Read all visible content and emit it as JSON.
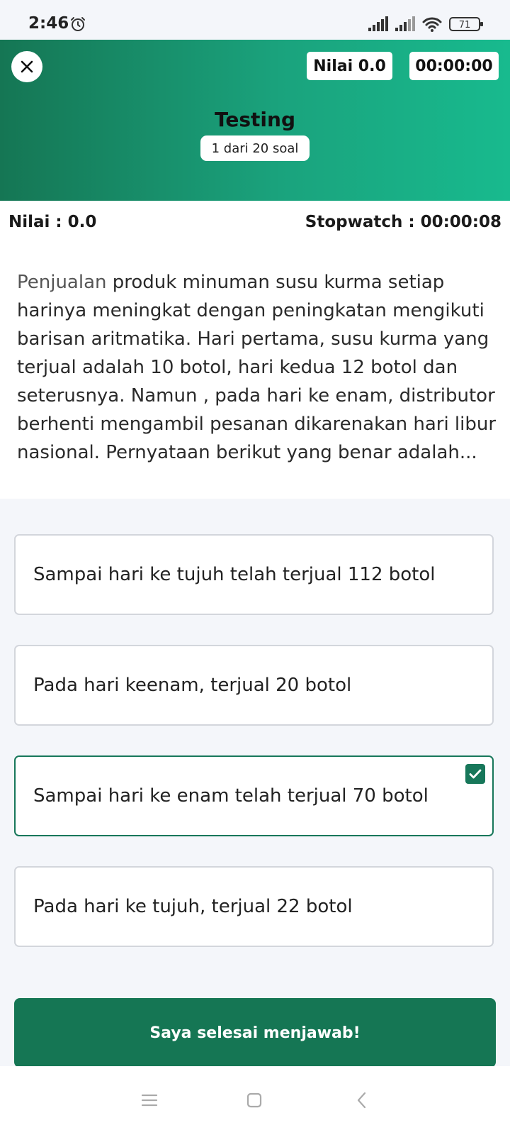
{
  "status_bar": {
    "time": "2:46",
    "battery": "71"
  },
  "header": {
    "score_chip": "Nilai 0.0",
    "timer_chip": "00:00:00",
    "title": "Testing",
    "progress": "1 dari 20 soal",
    "background_colors": [
      "#157654",
      "#18ba8e"
    ]
  },
  "info_bar": {
    "score": "Nilai : 0.0",
    "stopwatch": "Stopwatch : 00:00:08"
  },
  "question": {
    "first_word": "Penjualan",
    "rest": " produk minuman susu kurma setiap harinya meningkat dengan peningkatan mengikuti barisan aritmatika. Hari pertama, susu kurma yang terjual adalah 10 botol, hari kedua 12 botol dan seterusnya. Namun , pada hari ke enam, distributor berhenti mengambil pesanan dikarenakan hari libur nasional. Pernyataan berikut yang benar adalah..."
  },
  "options": [
    {
      "label": "Sampai hari ke tujuh telah terjual 112 botol",
      "selected": false
    },
    {
      "label": "Pada hari keenam, terjual 20 botol",
      "selected": false
    },
    {
      "label": "Sampai hari ke enam telah terjual 70 botol",
      "selected": true
    },
    {
      "label": "Pada hari ke tujuh, terjual 22 botol",
      "selected": false
    }
  ],
  "submit_label": "Saya selesai menjawab!",
  "accent_color": "#17775a",
  "nav_icons": [
    "menu-icon",
    "home-square-icon",
    "back-chevron-icon"
  ]
}
